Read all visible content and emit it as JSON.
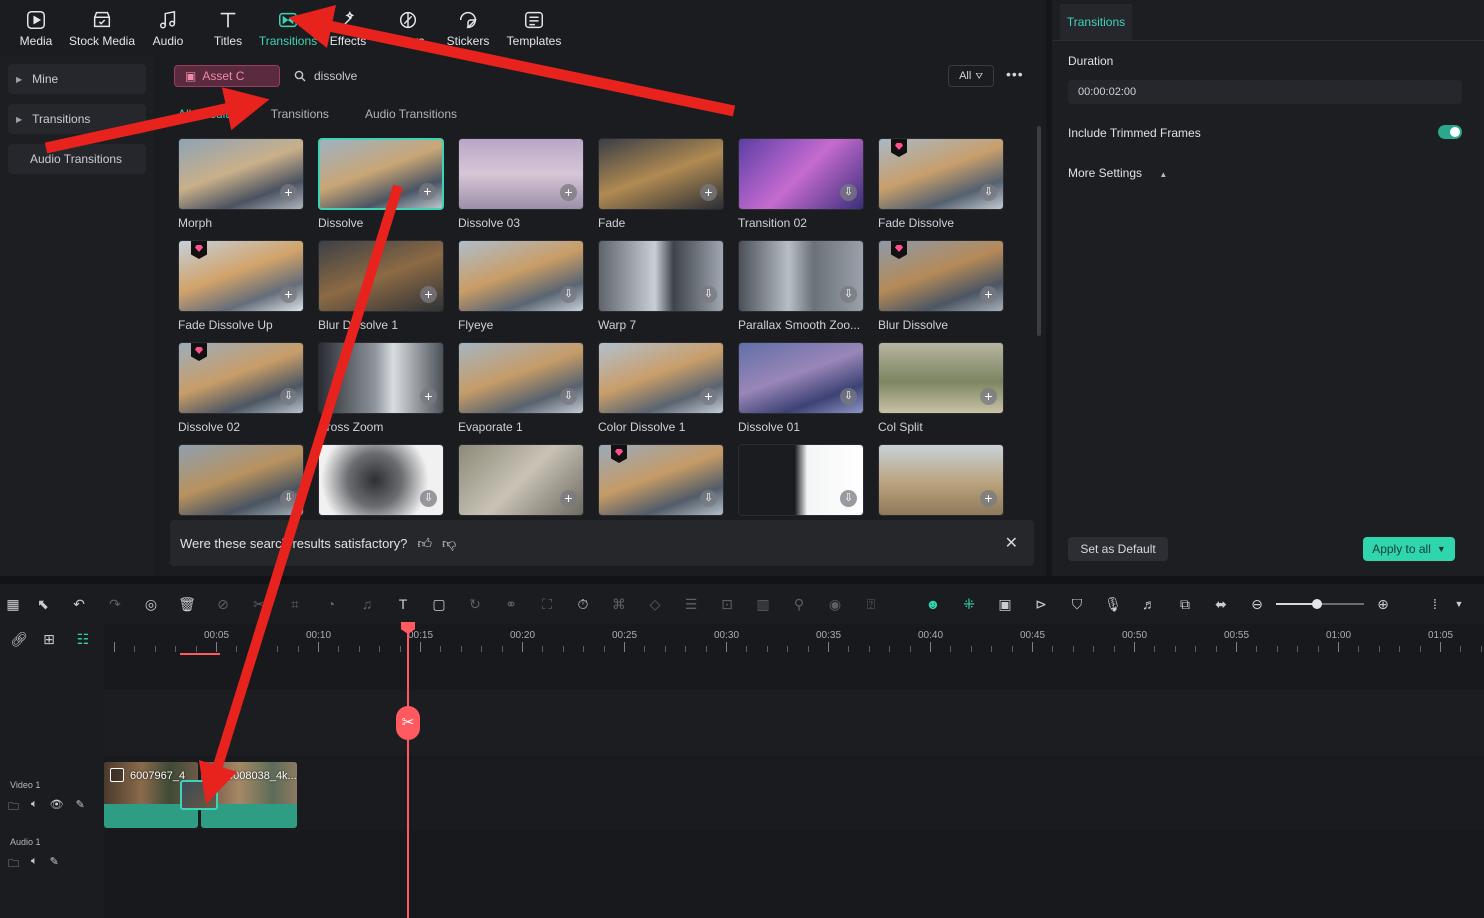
{
  "toolbar": {
    "items": [
      {
        "label": "Media",
        "icon": "media-icon"
      },
      {
        "label": "Stock Media",
        "icon": "stock-media-icon"
      },
      {
        "label": "Audio",
        "icon": "music-note-icon"
      },
      {
        "label": "Titles",
        "icon": "text-t-icon"
      },
      {
        "label": "Transitions",
        "icon": "transitions-icon",
        "active": true
      },
      {
        "label": "Effects",
        "icon": "effects-icon"
      },
      {
        "label": "Filters",
        "icon": "filters-icon"
      },
      {
        "label": "Stickers",
        "icon": "sticker-icon"
      },
      {
        "label": "Templates",
        "icon": "templates-icon"
      }
    ]
  },
  "sidebar": {
    "items": [
      {
        "label": "Mine"
      },
      {
        "label": "Transitions"
      },
      {
        "label": "Audio Transitions"
      }
    ]
  },
  "browser": {
    "asset_pill": "Asset C",
    "search_value": "dissolve",
    "filter_label": "All",
    "tabs": [
      "All Results",
      "Transitions",
      "Audio Transitions"
    ],
    "cards": [
      {
        "label": "Morph",
        "action": "+"
      },
      {
        "label": "Dissolve",
        "action": "+",
        "selected": true
      },
      {
        "label": "Dissolve 03",
        "action": "+"
      },
      {
        "label": "Fade",
        "action": "+"
      },
      {
        "label": "Transition 02",
        "action": "download"
      },
      {
        "label": "Fade Dissolve",
        "action": "download",
        "premium": true
      },
      {
        "label": "Fade Dissolve Up",
        "action": "+",
        "premium": true
      },
      {
        "label": "Blur Dissolve 1",
        "action": "+"
      },
      {
        "label": "Flyeye",
        "action": "download"
      },
      {
        "label": "Warp 7",
        "action": "download"
      },
      {
        "label": "Parallax Smooth Zoo...",
        "action": "download"
      },
      {
        "label": "Blur Dissolve",
        "action": "+",
        "premium": true
      },
      {
        "label": "Dissolve 02",
        "action": "download",
        "premium": true
      },
      {
        "label": "Cross Zoom",
        "action": "+"
      },
      {
        "label": "Evaporate 1",
        "action": "download"
      },
      {
        "label": "Color Dissolve 1",
        "action": "+"
      },
      {
        "label": "Dissolve 01",
        "action": "download"
      },
      {
        "label": "Col Split",
        "action": "+"
      },
      {
        "label": "",
        "action": "download"
      },
      {
        "label": "",
        "action": "download"
      },
      {
        "label": "",
        "action": "+"
      },
      {
        "label": "",
        "action": "download",
        "premium": true
      },
      {
        "label": "",
        "action": "download"
      },
      {
        "label": "",
        "action": "+"
      }
    ],
    "feedback": "Were these search results satisfactory?"
  },
  "right_panel": {
    "tab": "Transitions",
    "duration_label": "Duration",
    "duration_value": "00:00:02:00",
    "trimmed_label": "Include Trimmed Frames",
    "trimmed_on": true,
    "more_settings": "More Settings",
    "set_default": "Set as Default",
    "apply_all": "Apply to all"
  },
  "timeline": {
    "ruler_labels": [
      "00:05",
      "00:10",
      "00:15",
      "00:20",
      "00:25",
      "00:30",
      "00:35",
      "00:40",
      "00:45",
      "00:50",
      "00:55",
      "01:00",
      "01:05"
    ],
    "tracks": [
      {
        "name": "Video 1"
      },
      {
        "name": "Audio 1"
      }
    ],
    "clips": [
      {
        "name": "6007967_4"
      },
      {
        "name": "6008038_4k..."
      }
    ]
  },
  "colors": {
    "accent": "#3fd3b6",
    "playhead": "#ff5a5f",
    "annotation_arrow": "#e8221c",
    "premium": "#ff4f8d"
  }
}
